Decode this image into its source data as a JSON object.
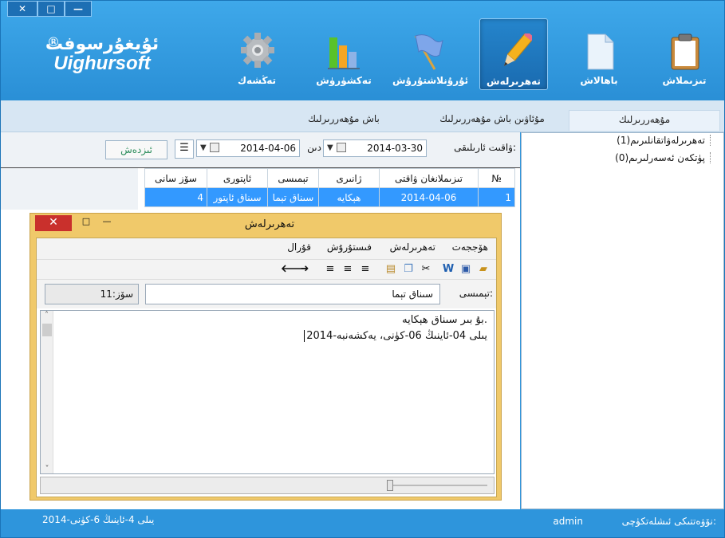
{
  "window_controls": {
    "close": "✕",
    "restore": "□",
    "minimize": "—"
  },
  "logo": {
    "uyghur": "ئۇيغۇرسوفت",
    "latin": "Uighursoft",
    "reg": "®"
  },
  "toolbar": {
    "items": [
      {
        "label": "تىزىملاش",
        "icon": "clipboard-icon"
      },
      {
        "label": "باھالاش",
        "icon": "document-icon"
      },
      {
        "label": "تەھرىرلەش",
        "icon": "pencil-icon",
        "selected": true
      },
      {
        "label": "ئۇرۇنلاشتۇرۇش",
        "icon": "flag-icon"
      },
      {
        "label": "تەكشۈرۈش",
        "icon": "bar-chart-icon"
      },
      {
        "label": "تەڭشەك",
        "icon": "gear-icon"
      }
    ]
  },
  "tabs": [
    {
      "label": "مۇھەررىرلىك",
      "selected": true
    },
    {
      "label": "مۇئاۋىن باش مۇھەررىرلىك",
      "selected": false
    },
    {
      "label": "باش مۇھەررىرلىك",
      "selected": false
    }
  ],
  "filter": {
    "time_label": "ۋاقىت ئارىلىقى:",
    "from_date": "2014-03-30",
    "to_label": "دىن",
    "to_date": "2014-04-06",
    "search_button": "ئىزدەش"
  },
  "table": {
    "columns": [
      "№",
      "تىزىملانغان ۋاقتى",
      "ژانىرى",
      "تېمىسى",
      "ئاپتورى",
      "سۆز سانى"
    ],
    "rows": [
      {
        "no": "1",
        "date": "2014-04-06",
        "genre": "ھېكايە",
        "title": "سىناق تېما",
        "author": "سىناق ئاپتور",
        "words": "4"
      }
    ]
  },
  "tree": [
    {
      "label": "تەھرىرلەۋاتقانلىرىم(1)"
    },
    {
      "label": "پۈتكەن ئەسەرلىرىم(0)"
    }
  ],
  "editor": {
    "title": "تەھرىرلەش",
    "close": "✕",
    "menu": [
      "ھۆججەت",
      "تەھرىرلەش",
      "فىستۇرۇش",
      "قۇرال"
    ],
    "subject_label": "تېمىسى:",
    "subject_value": "سىناق تېما",
    "word_count_label": "سۆز:11",
    "body_line1": "بۇ بىر سىناق ھېكايە.",
    "body_line2": "2014-يىلى 04-ئاينىڭ 06-كۈنى، يەكشەنبە"
  },
  "status": {
    "operator_label": "نۆۋەتتىكى ئىشلەتكۈچى:",
    "user": "admin",
    "date": "2014-يىلى 4-ئاينىڭ 6-كۈنى"
  },
  "colors": {
    "brand_blue": "#2e95dc",
    "selection": "#3399ff",
    "editor_frame": "#f0c96a",
    "close_red": "#c9302c"
  }
}
